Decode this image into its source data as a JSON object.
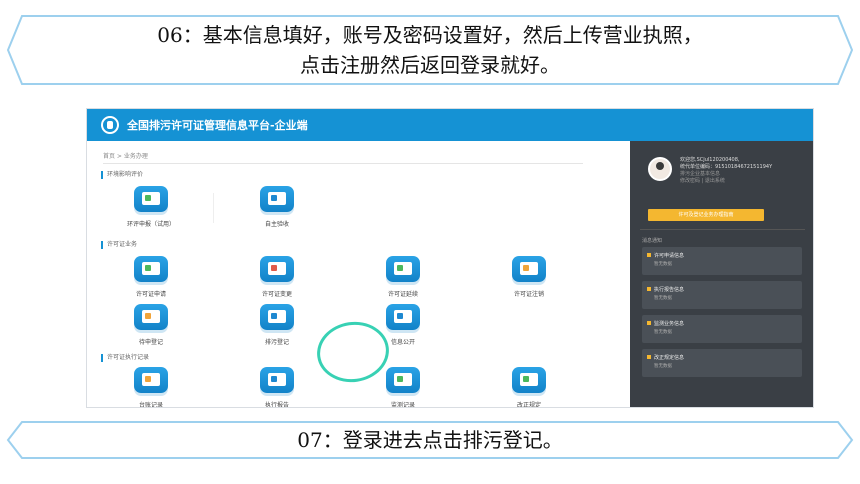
{
  "banner_top": {
    "line1": "06：基本信息填好，账号及密码设置好，然后上传营业执照，",
    "line2": "点击注册然后返回登录就好。"
  },
  "banner_bottom": {
    "text": "07：登录进去点击排污登记。"
  },
  "app": {
    "title": "全国排污许可证管理信息平台-企业端",
    "breadcrumb": "首页 > 业务办理",
    "sections": {
      "env": "环境影响评价",
      "permit": "许可证业务",
      "exec": "许可证执行记录"
    },
    "tiles": {
      "eia": "环评申报（试用）",
      "self": "自主验收",
      "apply": "许可证申请",
      "change": "许可证变更",
      "renew": "许可证延续",
      "cancel": "许可证注销",
      "pending": "待申登记",
      "register": "排污登记",
      "disclose": "信息公开",
      "ledger": "台账记录",
      "report": "执行报告",
      "monitor": "监测记录",
      "rectify": "改正规定"
    },
    "colors": {
      "header": "#1592d4",
      "sidebar": "#3a3f45",
      "highlight_circle": "#38d1b4",
      "button": "#f4b730"
    }
  },
  "sidebar": {
    "welcome": "欢迎您,SCJul120200408,",
    "code": "统代单位编码：91510184672151194Y",
    "info1": "排污企业基本信息",
    "info2": "修改密码 | 退出系统",
    "button": "许可及登记业务办理指南",
    "notice_label": "消息通知",
    "cards": [
      {
        "title": "许可申请信息",
        "sub": "暂无数据"
      },
      {
        "title": "执行报告信息",
        "sub": "暂无数据"
      },
      {
        "title": "监测业务信息",
        "sub": "暂无数据"
      },
      {
        "title": "改正规定信息",
        "sub": "暂无数据"
      }
    ]
  }
}
